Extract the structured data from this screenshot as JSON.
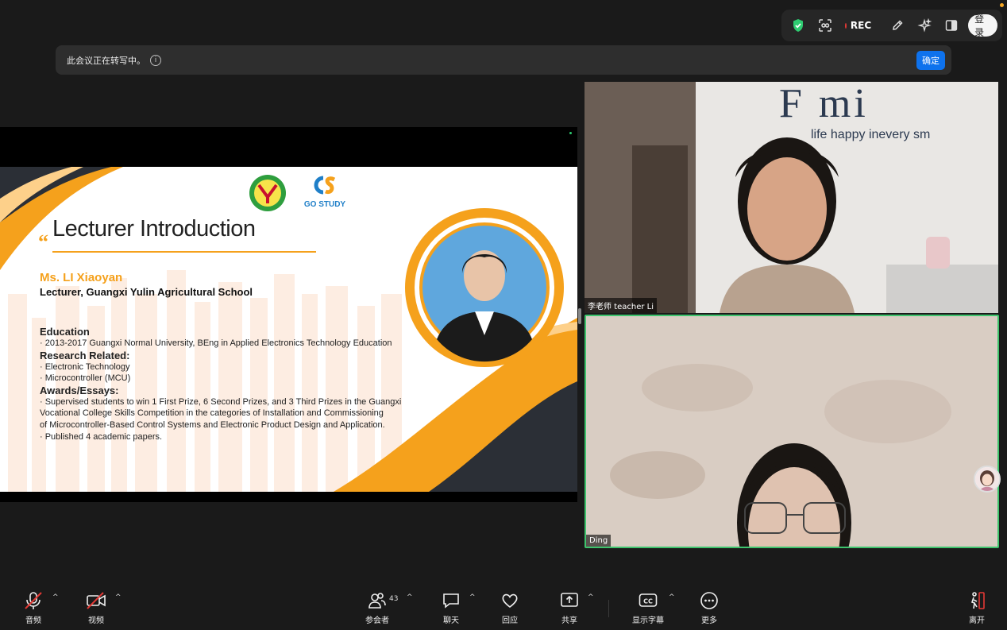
{
  "top_toolbar": {
    "rec_label": "REC",
    "login_label": "登录",
    "icons": [
      "shield-check-icon",
      "scan-icon",
      "record-dot-icon",
      "pencil-icon",
      "sparkle-icon",
      "panel-layout-icon"
    ]
  },
  "banner": {
    "text": "此会议正在转写中。",
    "info_symbol": "i",
    "confirm_label": "确定"
  },
  "slide": {
    "title": "Lecturer Introduction",
    "quote_mark": "“",
    "logo_text": "GO STUDY",
    "name": "Ms. LI Xiaoyan",
    "role": "Lecturer, Guangxi Yulin Agricultural School",
    "sections": [
      {
        "heading": "Education",
        "items": [
          "· 2013-2017 Guangxi Normal University, BEng in Applied Electronics Technology Education"
        ]
      },
      {
        "heading": "Research Related:",
        "items": [
          "· Electronic Technology",
          "· Microcontroller (MCU)"
        ]
      },
      {
        "heading": "Awards/Essays:",
        "items": [
          "· Supervised students to win 1 First Prize, 6 Second Prizes, and 3 Third Prizes in the Guangxi",
          "Vocational College Skills Competition in the categories of Installation and Commissioning",
          "of Microcontroller-Based Control Systems and Electronic Product Design and Application.",
          "· Published 4 academic papers."
        ]
      }
    ],
    "colors": {
      "accent": "#f5a11c",
      "dark": "#2b2f36"
    }
  },
  "videos": [
    {
      "name": "李老师 teacher Li",
      "wall_text_1": "F   mi",
      "wall_text_2": "life happy inevery sm"
    },
    {
      "name": "Ding",
      "active_speaker_color": "#3ec46d"
    }
  ],
  "bottom_bar": {
    "audio_label": "音频",
    "video_label": "视频",
    "participants_label": "参会者",
    "participants_count": "43",
    "chat_label": "聊天",
    "react_label": "回应",
    "share_label": "共享",
    "captions_label": "显示字幕",
    "captions_icon_text": "CC",
    "more_label": "更多",
    "leave_label": "离开",
    "caret": "^"
  }
}
